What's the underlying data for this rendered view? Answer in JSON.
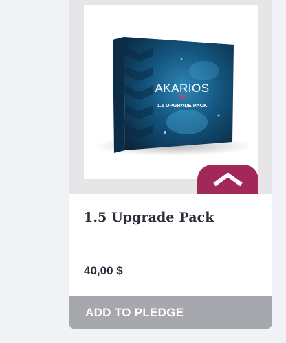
{
  "product": {
    "image": {
      "brand": "AKARIOS",
      "box_label": "1.5 UPGRADE PACK"
    },
    "title": "1.5 Upgrade Pack",
    "price": "40,00 $",
    "add_button_label": "ADD TO PLEDGE",
    "scroll_top_icon": "chevron-up-icon"
  },
  "colors": {
    "accent": "#a3285a",
    "button": "#a7a8ad",
    "background": "#f1f2f6",
    "text": "#2b2d3a"
  }
}
